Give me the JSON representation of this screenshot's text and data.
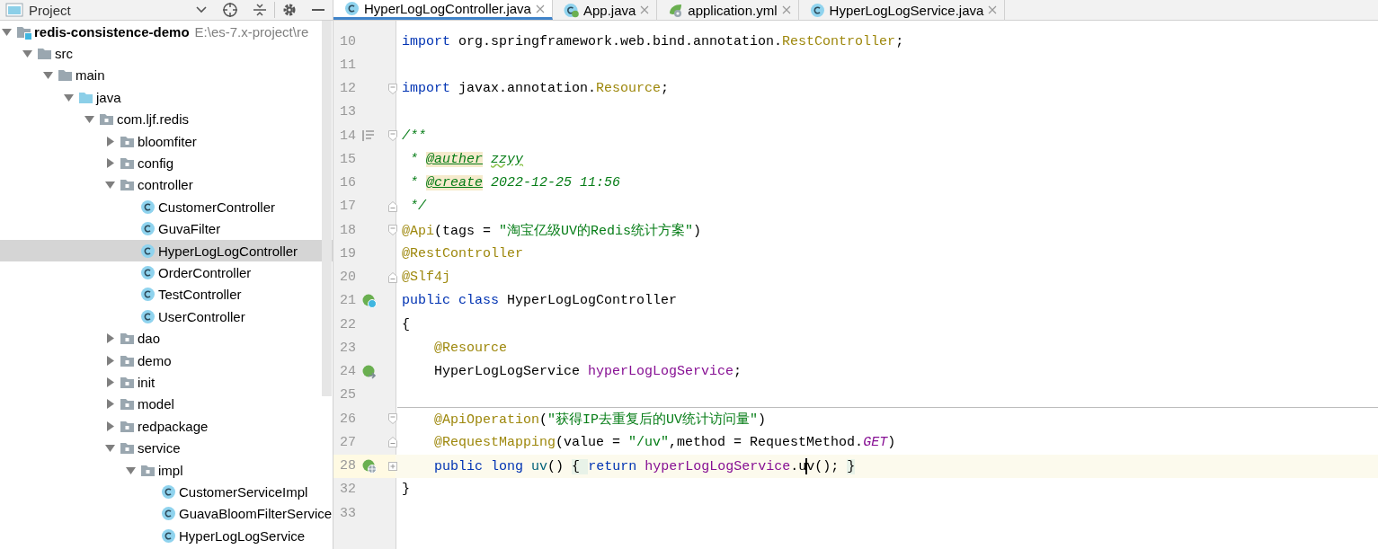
{
  "project_panel": {
    "title": "Project"
  },
  "tree": {
    "items": [
      {
        "label": "redis-consistence-demo",
        "hint": "E:\\es-7.x-project\\re",
        "kind": "module",
        "expanded": true,
        "selected": false,
        "children": [
          {
            "label": "src",
            "kind": "folder",
            "expanded": true,
            "selected": false,
            "children": [
              {
                "label": "main",
                "kind": "folder",
                "expanded": true,
                "selected": false,
                "children": [
                  {
                    "label": "java",
                    "kind": "source",
                    "expanded": true,
                    "selected": false,
                    "children": [
                      {
                        "label": "com.ljf.redis",
                        "kind": "package",
                        "expanded": true,
                        "selected": false,
                        "children": [
                          {
                            "label": "bloomfiter",
                            "kind": "package",
                            "expanded": false,
                            "selected": false
                          },
                          {
                            "label": "config",
                            "kind": "package",
                            "expanded": false,
                            "selected": false
                          },
                          {
                            "label": "controller",
                            "kind": "package",
                            "expanded": true,
                            "selected": false,
                            "children": [
                              {
                                "label": "CustomerController",
                                "kind": "class",
                                "selected": false
                              },
                              {
                                "label": "GuvaFilter",
                                "kind": "class",
                                "selected": false
                              },
                              {
                                "label": "HyperLogLogController",
                                "kind": "class",
                                "selected": true
                              },
                              {
                                "label": "OrderController",
                                "kind": "class",
                                "selected": false
                              },
                              {
                                "label": "TestController",
                                "kind": "class",
                                "selected": false
                              },
                              {
                                "label": "UserController",
                                "kind": "class",
                                "selected": false
                              }
                            ]
                          },
                          {
                            "label": "dao",
                            "kind": "package",
                            "expanded": false,
                            "selected": false
                          },
                          {
                            "label": "demo",
                            "kind": "package",
                            "expanded": false,
                            "selected": false
                          },
                          {
                            "label": "init",
                            "kind": "package",
                            "expanded": false,
                            "selected": false
                          },
                          {
                            "label": "model",
                            "kind": "package",
                            "expanded": false,
                            "selected": false
                          },
                          {
                            "label": "redpackage",
                            "kind": "package",
                            "expanded": false,
                            "selected": false
                          },
                          {
                            "label": "service",
                            "kind": "package",
                            "expanded": true,
                            "selected": false,
                            "children": [
                              {
                                "label": "impl",
                                "kind": "package",
                                "expanded": true,
                                "selected": false,
                                "children": [
                                  {
                                    "label": "CustomerServiceImpl",
                                    "kind": "class",
                                    "selected": false
                                  },
                                  {
                                    "label": "GuavaBloomFilterService",
                                    "kind": "class",
                                    "selected": false
                                  },
                                  {
                                    "label": "HyperLogLogService",
                                    "kind": "class",
                                    "selected": false
                                  }
                                ]
                              }
                            ]
                          }
                        ]
                      }
                    ]
                  }
                ]
              }
            ]
          }
        ]
      }
    ]
  },
  "tabs": [
    {
      "label": "HyperLogLogController.java",
      "kind": "class",
      "selected": true
    },
    {
      "label": "App.java",
      "kind": "app",
      "selected": false
    },
    {
      "label": "application.yml",
      "kind": "yml",
      "selected": false
    },
    {
      "label": "HyperLogLogService.java",
      "kind": "class",
      "selected": false
    }
  ],
  "editor": {
    "lines": [
      {
        "number": "10",
        "current": false,
        "tokens": [
          {
            "kind": "kw",
            "text": "import"
          },
          {
            "kind": "p",
            "text": " org.springframework.web.bind.annotation."
          },
          {
            "kind": "ann",
            "text": "RestController"
          },
          {
            "kind": "p",
            "text": ";"
          }
        ]
      },
      {
        "number": "11",
        "current": false
      },
      {
        "number": "12",
        "current": false,
        "fold_marker": {
          "kind": "start"
        },
        "tokens": [
          {
            "kind": "kw",
            "text": "import"
          },
          {
            "kind": "p",
            "text": " javax.annotation."
          },
          {
            "kind": "ann",
            "text": "Resource"
          },
          {
            "kind": "p",
            "text": ";"
          }
        ]
      },
      {
        "number": "13",
        "current": false
      },
      {
        "number": "14",
        "current": false,
        "gutter_icon": {
          "kind": "doc"
        },
        "fold_marker": {
          "kind": "start"
        },
        "tokens": [
          {
            "kind": "doc",
            "text": "/**"
          }
        ]
      },
      {
        "number": "15",
        "current": false,
        "tokens": [
          {
            "kind": "doc",
            "text": " * "
          },
          {
            "kind": "tag",
            "text": "@auther"
          },
          {
            "kind": "typo",
            "text": " zzyy"
          }
        ]
      },
      {
        "number": "16",
        "current": false,
        "tokens": [
          {
            "kind": "doc",
            "text": " * "
          },
          {
            "kind": "tag",
            "text": "@create"
          },
          {
            "kind": "doc",
            "text": " 2022-12-25 11:56"
          }
        ]
      },
      {
        "number": "17",
        "current": false,
        "fold_marker": {
          "kind": "end"
        },
        "tokens": [
          {
            "kind": "doc",
            "text": " */"
          }
        ]
      },
      {
        "number": "18",
        "current": false,
        "fold_marker": {
          "kind": "start"
        },
        "tokens": [
          {
            "kind": "ann",
            "text": "@Api"
          },
          {
            "kind": "p",
            "text": "(tags = "
          },
          {
            "kind": "str",
            "text": "\"淘宝亿级UV的Redis统计方案\""
          },
          {
            "kind": "p",
            "text": ")"
          }
        ]
      },
      {
        "number": "19",
        "current": false,
        "tokens": [
          {
            "kind": "ann",
            "text": "@RestController"
          }
        ]
      },
      {
        "number": "20",
        "current": false,
        "fold_marker": {
          "kind": "end"
        },
        "tokens": [
          {
            "kind": "ann",
            "text": "@Slf4j"
          }
        ]
      },
      {
        "number": "21",
        "current": false,
        "gutter_icon": {
          "kind": "bean"
        },
        "tokens": [
          {
            "kind": "kw",
            "text": "public"
          },
          {
            "kind": "kw",
            "text": " class"
          },
          {
            "kind": "p",
            "text": " HyperLogLogController"
          }
        ]
      },
      {
        "number": "22",
        "current": false,
        "tokens": [
          {
            "kind": "p",
            "text": "{"
          }
        ]
      },
      {
        "number": "23",
        "current": false,
        "tokens": [
          {
            "kind": "ann",
            "text": "    @Resource"
          }
        ]
      },
      {
        "number": "24",
        "current": false,
        "gutter_icon": {
          "kind": "inject"
        },
        "tokens": [
          {
            "kind": "p",
            "text": "    HyperLogLogService "
          },
          {
            "kind": "field",
            "text": "hyperLogLogService"
          },
          {
            "kind": "p",
            "text": ";"
          }
        ]
      },
      {
        "number": "25",
        "current": false
      },
      {
        "number": "26",
        "current": false,
        "method_separator": true,
        "fold_marker": {
          "kind": "start"
        },
        "tokens": [
          {
            "kind": "ann",
            "text": "    @ApiOperation"
          },
          {
            "kind": "p",
            "text": "("
          },
          {
            "kind": "str",
            "text": "\"获得IP去重复后的UV统计访问量\""
          },
          {
            "kind": "p",
            "text": ")"
          }
        ]
      },
      {
        "number": "27",
        "current": false,
        "fold_marker": {
          "kind": "end"
        },
        "tokens": [
          {
            "kind": "ann",
            "text": "    @RequestMapping"
          },
          {
            "kind": "p",
            "text": "(value = "
          },
          {
            "kind": "str",
            "text": "\"/uv\""
          },
          {
            "kind": "p",
            "text": ",method = RequestMethod."
          },
          {
            "kind": "const",
            "text": "GET"
          },
          {
            "kind": "p",
            "text": ")"
          }
        ]
      },
      {
        "number": "28",
        "current": true,
        "gutter_icon": {
          "kind": "web"
        },
        "fold_marker": {
          "kind": "collapsed"
        },
        "tokens": [
          {
            "kind": "kw",
            "text": "    public"
          },
          {
            "kind": "kw",
            "text": " long"
          },
          {
            "kind": "method",
            "text": " uv"
          },
          {
            "kind": "p",
            "text": "() "
          },
          {
            "kind": "brace",
            "text": "{ "
          },
          {
            "kind": "kw",
            "text": "return"
          },
          {
            "kind": "field",
            "text": " hyperLogLogService"
          },
          {
            "kind": "p",
            "text": ".u"
          },
          {
            "kind": "caret"
          },
          {
            "kind": "p",
            "text": "v();"
          },
          {
            "kind": "brace",
            "text": " }"
          }
        ]
      },
      {
        "number": "32",
        "current": false,
        "tokens": [
          {
            "kind": "p",
            "text": "}"
          }
        ]
      },
      {
        "number": "33",
        "current": false
      }
    ]
  }
}
